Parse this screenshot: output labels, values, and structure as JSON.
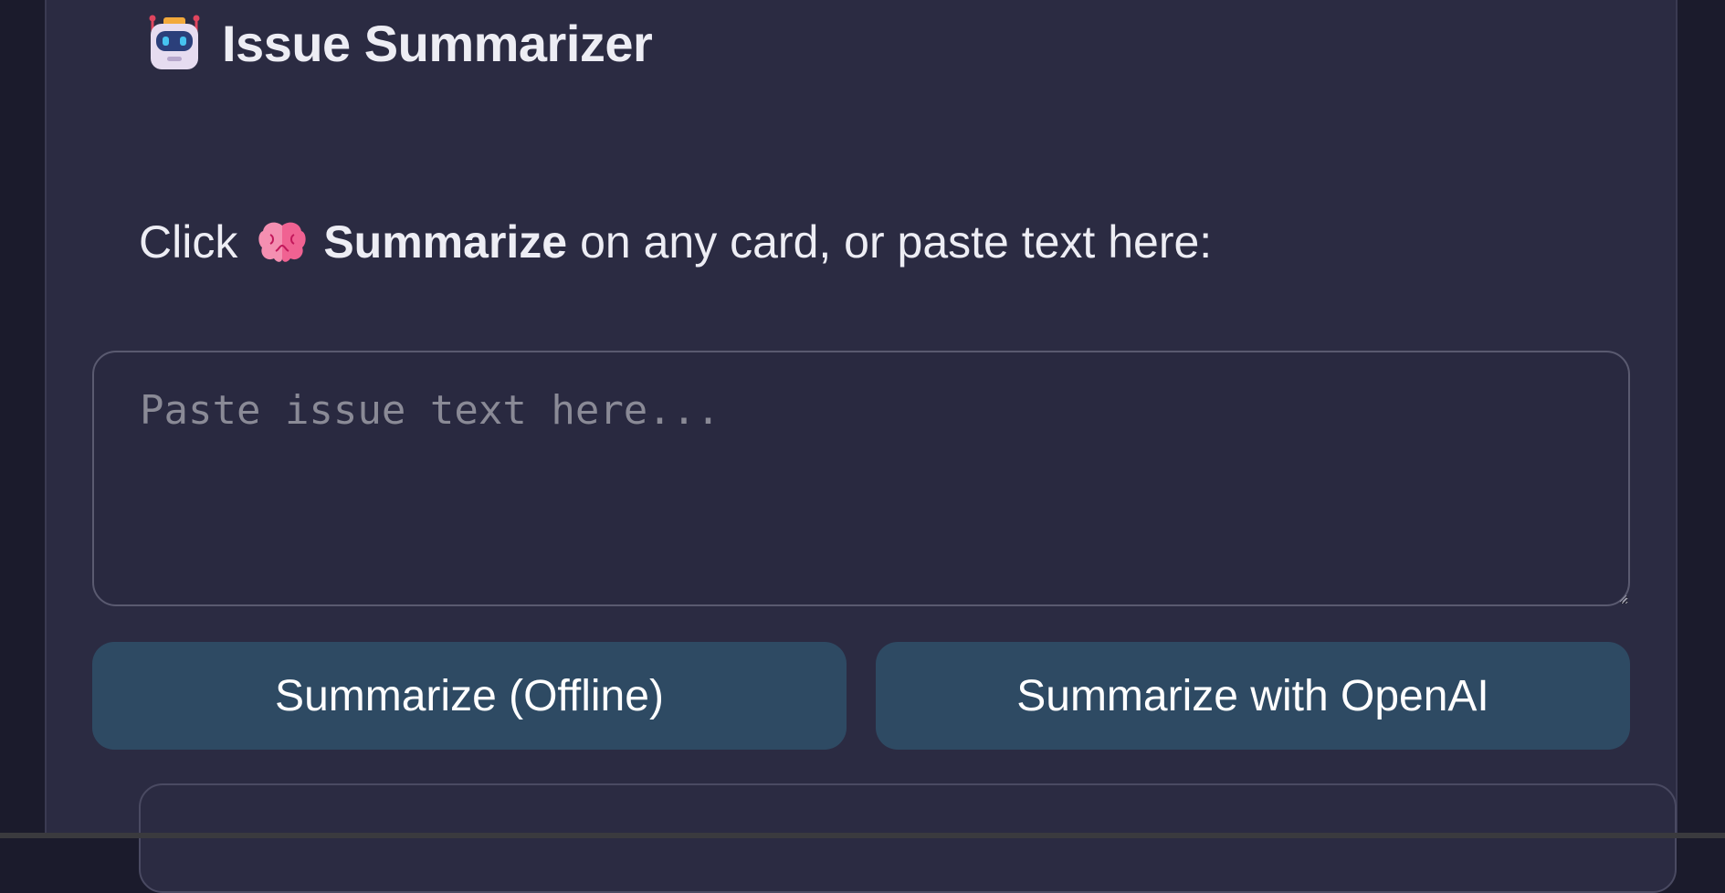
{
  "header": {
    "icon": "robot-icon",
    "title": "Issue Summarizer"
  },
  "instruction": {
    "prefix": "Click",
    "icon": "brain-icon",
    "bold": "Summarize",
    "suffix": "on any card, or paste text here:"
  },
  "input": {
    "placeholder": "Paste issue text here...",
    "value": ""
  },
  "buttons": {
    "offline_label": "Summarize (Offline)",
    "openai_label": "Summarize with OpenAI"
  },
  "colors": {
    "background": "#1b1b2c",
    "panel": "#2b2b42",
    "button": "#2e4a63",
    "text": "#ededf4",
    "placeholder": "#8a8a96"
  }
}
